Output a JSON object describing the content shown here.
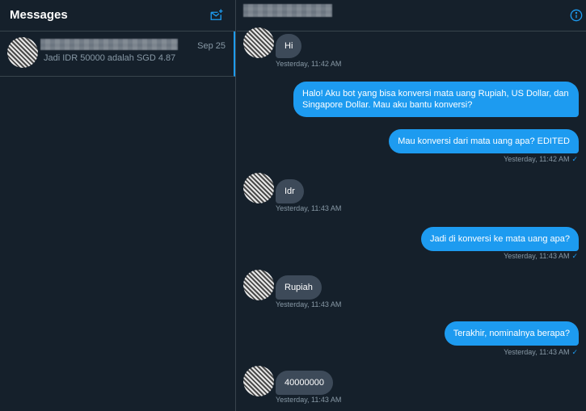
{
  "sidebar": {
    "title": "Messages",
    "conversation": {
      "date": "Sep 25",
      "preview": "Jadi IDR 50000 adalah SGD 4.87"
    }
  },
  "chat": {
    "messages": [
      {
        "direction": "in",
        "text": "Hi",
        "time": "Yesterday, 11:42 AM"
      },
      {
        "direction": "out",
        "text": "Halo! Aku bot yang bisa konversi mata uang Rupiah, US Dollar, dan Singapore Dollar. Mau aku bantu konversi?"
      },
      {
        "direction": "out",
        "text": "Mau konversi dari mata uang apa? EDITED",
        "time": "Yesterday, 11:42 AM"
      },
      {
        "direction": "in",
        "text": "Idr",
        "time": "Yesterday, 11:43 AM"
      },
      {
        "direction": "out",
        "text": "Jadi di konversi ke mata uang apa?",
        "time": "Yesterday, 11:43 AM"
      },
      {
        "direction": "in",
        "text": "Rupiah",
        "time": "Yesterday, 11:43 AM"
      },
      {
        "direction": "out",
        "text": "Terakhir, nominalnya berapa?",
        "time": "Yesterday, 11:43 AM"
      },
      {
        "direction": "in",
        "text": "40000000",
        "time": "Yesterday, 11:43 AM"
      }
    ]
  },
  "icons": {
    "compose": "compose-message-icon",
    "info": "info-icon",
    "read": "checkmark-icon"
  },
  "colors": {
    "background": "#15202b",
    "divider": "#38444d",
    "accent": "#1d9bf0",
    "incoming_bubble": "#3d4a59",
    "muted_text": "#8899a6"
  }
}
